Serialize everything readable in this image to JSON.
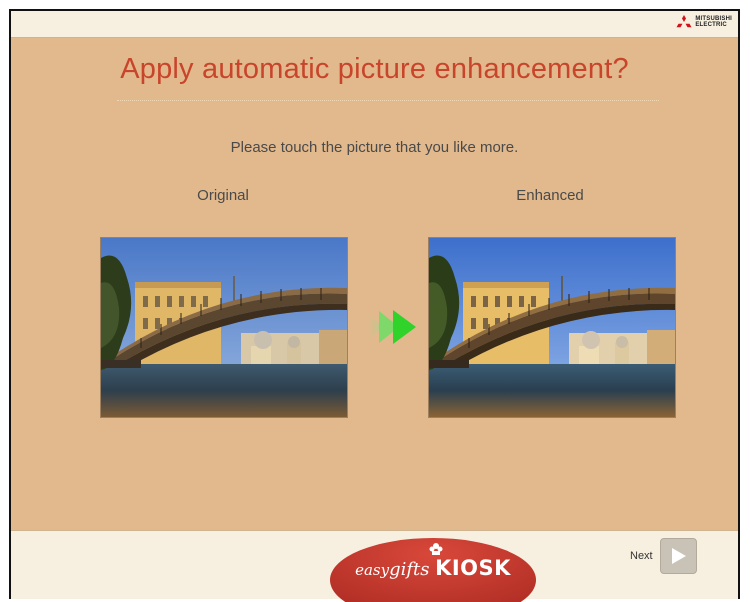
{
  "header": {
    "brand_line1": "MITSUBISHI",
    "brand_line2": "ELECTRIC",
    "brand_icon": "three-diamonds-logo"
  },
  "main": {
    "title": "Apply automatic picture enhancement?",
    "instruction": "Please touch the picture that you like more.",
    "original_label": "Original",
    "enhanced_label": "Enhanced",
    "arrow_icon": "double-play-arrow"
  },
  "footer": {
    "logo_easy": "easy",
    "logo_gifts": "gifts",
    "logo_kiosk": "KIOSK",
    "next_label": "Next",
    "next_icon": "play-triangle"
  },
  "colors": {
    "background": "#e2b98d",
    "title": "#c8452b",
    "bar": "#f7f0e0",
    "logo_red": "#c0362c",
    "arrow_green": "#2fd32a"
  }
}
